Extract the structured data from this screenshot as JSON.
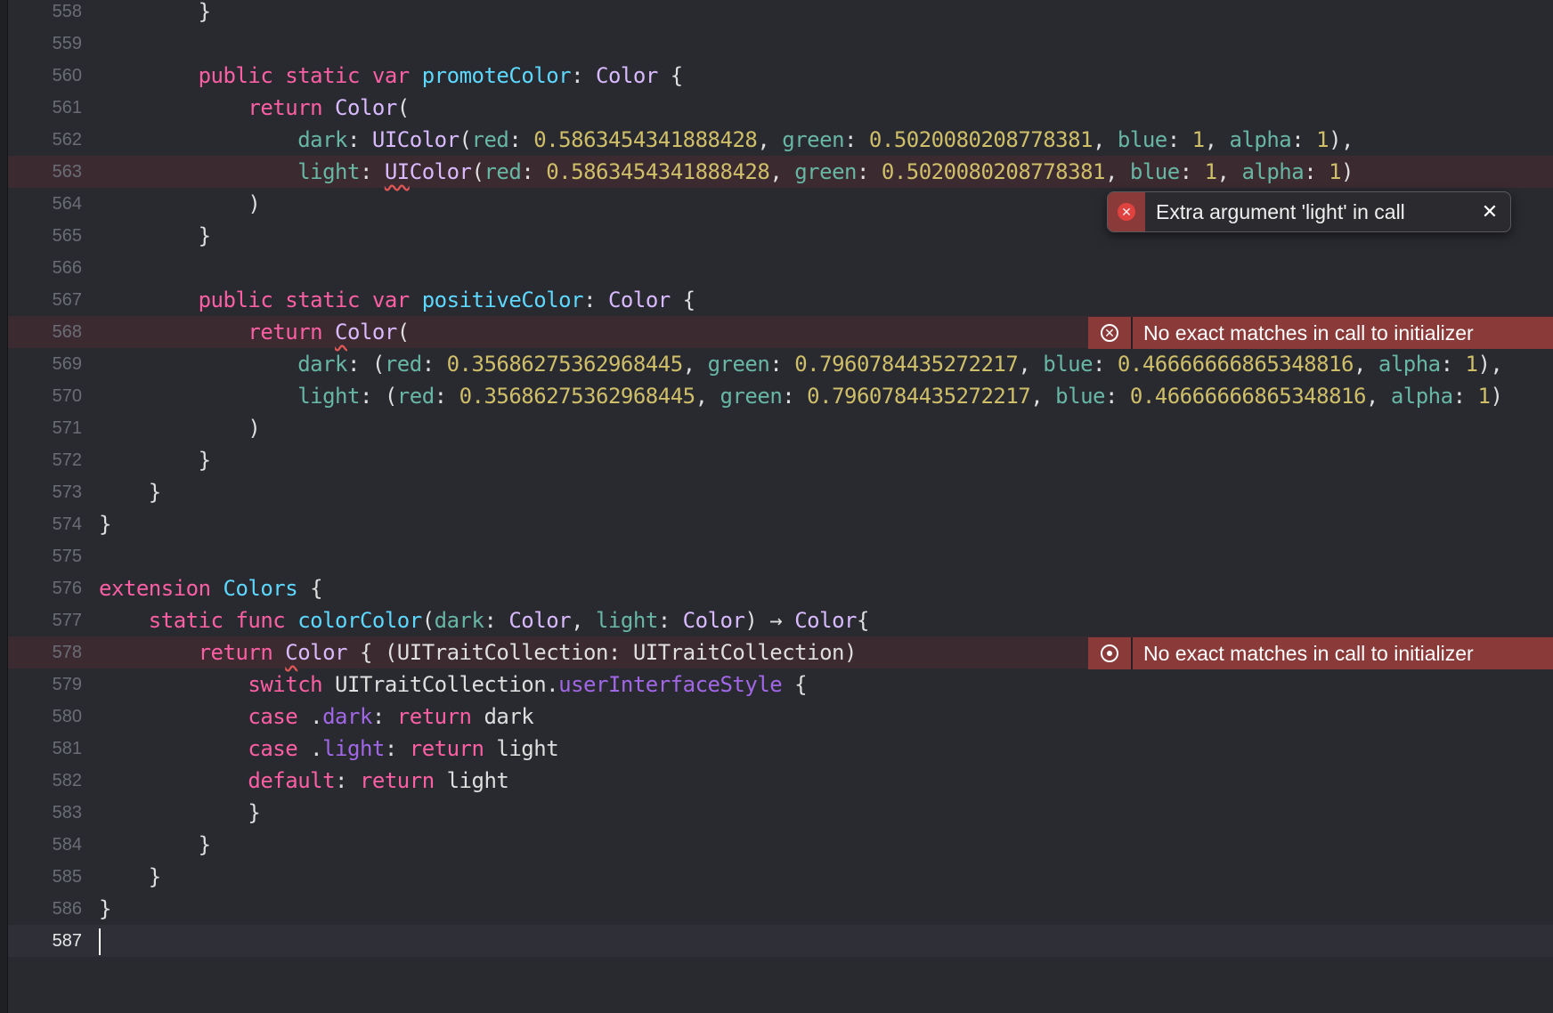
{
  "lines": [
    {
      "n": "558",
      "t": "        }",
      "cls": ""
    },
    {
      "n": "559",
      "t": "",
      "cls": ""
    },
    {
      "n": "560",
      "h": "        <span class=\"k\">public</span> <span class=\"k\">static</span> <span class=\"k\">var</span> <span class=\"d\">promoteColor</span>: <span class=\"t\">Color</span> {",
      "cls": ""
    },
    {
      "n": "561",
      "h": "            <span class=\"k\">return</span> <span class=\"t\">Color</span>(",
      "cls": ""
    },
    {
      "n": "562",
      "h": "                <span class=\"a\">dark</span>: <span class=\"t\">UIColor</span>(<span class=\"a\">red</span>: <span class=\"n\">0.5863454341888428</span>, <span class=\"a\">green</span>: <span class=\"n\">0.5020080208778381</span>, <span class=\"a\">blue</span>: <span class=\"n\">1</span>, <span class=\"a\">alpha</span>: <span class=\"n\">1</span>),",
      "cls": ""
    },
    {
      "n": "563",
      "h": "                <span class=\"a\">light</span>: <span class=\"t sq\">UI</span><span class=\"t\">Color</span>(<span class=\"a\">red</span>: <span class=\"n\">0.5863454341888428</span>, <span class=\"a\">green</span>: <span class=\"n\">0.5020080208778381</span>, <span class=\"a\">blue</span>: <span class=\"n\">1</span>, <span class=\"a\">alpha</span>: <span class=\"n\">1</span>)",
      "cls": "err"
    },
    {
      "n": "564",
      "t": "            )",
      "cls": ""
    },
    {
      "n": "565",
      "t": "        }",
      "cls": ""
    },
    {
      "n": "566",
      "t": "",
      "cls": ""
    },
    {
      "n": "567",
      "h": "        <span class=\"k\">public</span> <span class=\"k\">static</span> <span class=\"k\">var</span> <span class=\"d\">positiveColor</span>: <span class=\"t\">Color</span> {",
      "cls": ""
    },
    {
      "n": "568",
      "h": "            <span class=\"k\">return</span> <span class=\"t sq\">C</span><span class=\"t\">olor</span>(",
      "cls": "err"
    },
    {
      "n": "569",
      "h": "                <span class=\"a\">dark</span>: (<span class=\"a\">red</span>: <span class=\"n\">0.35686275362968445</span>, <span class=\"a\">green</span>: <span class=\"n\">0.7960784435272217</span>, <span class=\"a\">blue</span>: <span class=\"n\">0.46666666865348816</span>, <span class=\"a\">alpha</span>: <span class=\"n\">1</span>),",
      "cls": ""
    },
    {
      "n": "570",
      "h": "                <span class=\"a\">light</span>: (<span class=\"a\">red</span>: <span class=\"n\">0.35686275362968445</span>, <span class=\"a\">green</span>: <span class=\"n\">0.7960784435272217</span>, <span class=\"a\">blue</span>: <span class=\"n\">0.46666666865348816</span>, <span class=\"a\">alpha</span>: <span class=\"n\">1</span>)",
      "cls": ""
    },
    {
      "n": "571",
      "t": "            )",
      "cls": ""
    },
    {
      "n": "572",
      "t": "        }",
      "cls": ""
    },
    {
      "n": "573",
      "t": "    }",
      "cls": ""
    },
    {
      "n": "574",
      "t": "}",
      "cls": ""
    },
    {
      "n": "575",
      "t": "",
      "cls": ""
    },
    {
      "n": "576",
      "h": "<span class=\"k\">extension</span> <span class=\"d\">Colors</span> {",
      "cls": ""
    },
    {
      "n": "577",
      "h": "    <span class=\"k\">static</span> <span class=\"k\">func</span> <span class=\"d\">colorColor</span>(<span class=\"a\">dark</span>: <span class=\"t\">Color</span>, <span class=\"a\">light</span>: <span class=\"t\">Color</span>) → <span class=\"t\">Color</span>{",
      "cls": ""
    },
    {
      "n": "578",
      "h": "        <span class=\"k\">return</span> <span class=\"t sq\">C</span><span class=\"t\">olor</span> { (UITraitCollection: UITraitCollection)",
      "cls": "err"
    },
    {
      "n": "579",
      "h": "            <span class=\"k\">switch</span> UITraitCollection.<span class=\"p\">userInterfaceStyle</span> {",
      "cls": ""
    },
    {
      "n": "580",
      "h": "            <span class=\"k\">case</span> .<span class=\"p\">dark</span>: <span class=\"k\">return</span> dark",
      "cls": ""
    },
    {
      "n": "581",
      "h": "            <span class=\"k\">case</span> .<span class=\"p\">light</span>: <span class=\"k\">return</span> light",
      "cls": ""
    },
    {
      "n": "582",
      "h": "            <span class=\"k\">default</span>: <span class=\"k\">return</span> light",
      "cls": ""
    },
    {
      "n": "583",
      "t": "            }",
      "cls": ""
    },
    {
      "n": "584",
      "t": "        }",
      "cls": ""
    },
    {
      "n": "585",
      "t": "    }",
      "cls": ""
    },
    {
      "n": "586",
      "t": "}",
      "cls": ""
    },
    {
      "n": "587",
      "t": "",
      "cls": "cur",
      "caret": true
    }
  ],
  "popover": {
    "message": "Extra argument 'light' in call",
    "close": "✕"
  },
  "banners": [
    {
      "line": "568",
      "message": "No exact matches in call to initializer",
      "icon": "error-x-icon"
    },
    {
      "line": "578",
      "message": "No exact matches in call to initializer",
      "icon": "error-dot-icon"
    }
  ],
  "colors": {
    "background": "#292a30",
    "error_line": "#3b2a2f",
    "error_banner": "#8a3a38",
    "keyword": "#fc5fa3",
    "type": "#dabaff",
    "number": "#d0bf69"
  }
}
